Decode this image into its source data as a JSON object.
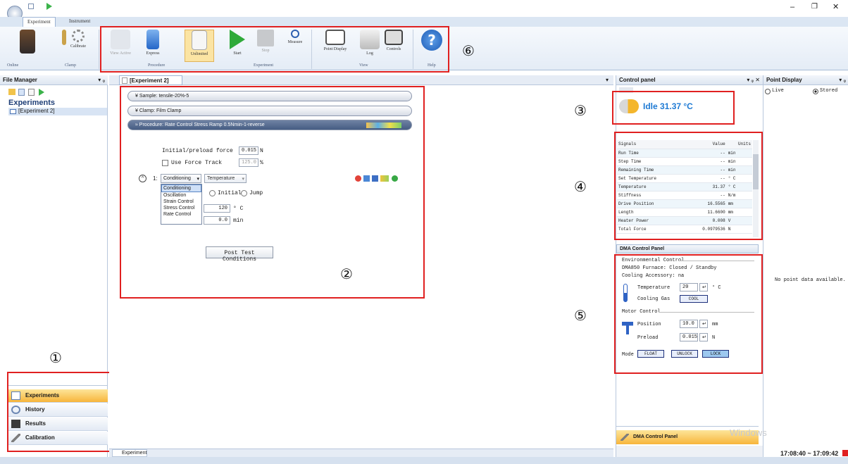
{
  "window": {
    "minimize": "–",
    "maximize": "❐",
    "close": "✕"
  },
  "ribbon": {
    "tabs": [
      "Experiment",
      "Instrument"
    ],
    "groups": {
      "online": "Online",
      "clamp": "Clamp",
      "procedure": "Procedure",
      "experiment": "Experiment",
      "view": "View",
      "help": "Help"
    },
    "buttons": {
      "calibrate": "Calibrate",
      "view_active": "View Active",
      "express": "Express",
      "unlimited": "Unlimited",
      "start": "Start",
      "stop": "Stop",
      "measure": "Measure",
      "point_display": "Point Display",
      "log": "Log",
      "controls": "Controls"
    }
  },
  "annotations": [
    "①",
    "②",
    "③",
    "④",
    "⑤",
    "⑥"
  ],
  "file_manager": {
    "title": "File Manager",
    "pin": "▾ ᵩ",
    "heading": "Experiments",
    "items": [
      "[Experiment 2]"
    ],
    "nav": [
      "Experiments",
      "History",
      "Results",
      "Calibration"
    ]
  },
  "document": {
    "tab": "[Experiment 2]",
    "bottom_tab": "Experiment",
    "sample": "Sample: tensile-20%-5",
    "clamp": "Clamp: Film Clamp",
    "procedure": "Procedure: Rate Control Stress Ramp 0.5Nmin-1-reverse",
    "preload_label": "Initial/preload force",
    "preload_value": "0.015",
    "preload_unit": "N",
    "force_track_label": "Use Force Track",
    "force_track_value": "125.0",
    "force_track_unit": "%",
    "step_num": "1:",
    "step_type": "Conditioning",
    "step_sub": "Temperature",
    "options": [
      "Conditioning",
      "Oscillation",
      "Strain Control",
      "Stress Control",
      "Rate Control"
    ],
    "initial": "Initial",
    "jump": "Jump",
    "temp_value": "120",
    "temp_unit": "° C",
    "time_value": "0.0",
    "time_unit": "min",
    "post_test": "Post Test Conditions"
  },
  "control_panel": {
    "title": "Control panel",
    "pin": "▾ ᵩ ✕",
    "status": "Idle 31.37 °C",
    "sig_header": [
      "Signals",
      "Value",
      "Units"
    ],
    "signals": [
      [
        "Run Time",
        "--",
        "min"
      ],
      [
        "Step Time",
        "--",
        "min"
      ],
      [
        "Remaining Time",
        "--",
        "min"
      ],
      [
        "Set Temperature",
        "--",
        "° C"
      ],
      [
        "Temperature",
        "31.37",
        "° C"
      ],
      [
        "Stiffness",
        "--",
        "N/m"
      ],
      [
        "Drive Position",
        "16.5565",
        "mm"
      ],
      [
        "Length",
        "11.6600",
        "mm"
      ],
      [
        "Heater Power",
        "0.008",
        "V"
      ],
      [
        "Total Force",
        "0.0979536",
        "N"
      ]
    ],
    "dma_title": "DMA Control Panel",
    "env_label": "Environmental Control",
    "furnace": "DMA850 Furnace: Closed / Standby",
    "cooling_acc": "Cooling Accessory: na",
    "temperature_label": "Temperature",
    "temperature_value": "20",
    "temperature_unit": "° C",
    "cooling_gas_label": "Cooling Gas",
    "cooling_gas_btn": "COOL",
    "motor_label": "Motor Control",
    "position_label": "Position",
    "position_value": "10.0",
    "position_unit": "mm",
    "preload_label": "Preload",
    "preload_value": "0.015",
    "preload_unit": "N",
    "mode_label": "Mode",
    "modes": [
      "FLOAT",
      "UNLOCK",
      "LOCK"
    ],
    "footer": "DMA Control Panel"
  },
  "point_display": {
    "title": "Point Display",
    "pin": "▾ ᵩ",
    "live": "Live",
    "stored": "Stored",
    "empty": "No point data available."
  },
  "watermark": "Windows",
  "clock": "17:08:40 ~ 17:09:42"
}
